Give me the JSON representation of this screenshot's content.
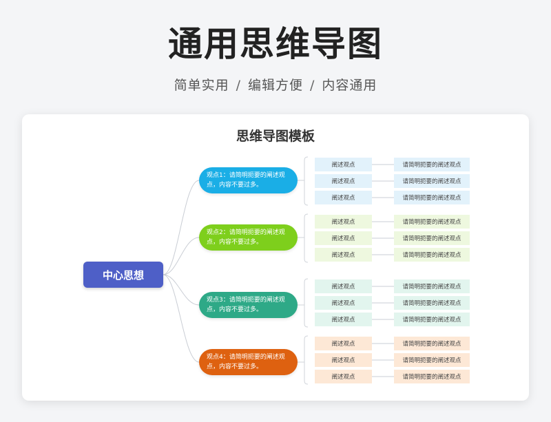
{
  "header": {
    "title": "通用思维导图",
    "tags": [
      "简单实用",
      "编辑方便",
      "内容通用"
    ],
    "separator": "/"
  },
  "template_title": "思维导图模板",
  "center": {
    "label": "中心思想",
    "color": "#4e5fc7"
  },
  "branches": [
    {
      "label": "观点1：请简明扼要的阐述观点，内容不要过多。",
      "color": "#1aaee6",
      "leaf_color": "#e2f2fb",
      "leaves": [
        {
          "left": "阐述观点",
          "right": "请简明扼要的阐述观点"
        },
        {
          "left": "阐述观点",
          "right": "请简明扼要的阐述观点"
        },
        {
          "left": "阐述观点",
          "right": "请简明扼要的阐述观点"
        }
      ]
    },
    {
      "label": "观点2：请简明扼要的阐述观点，内容不要过多。",
      "color": "#7ecf1c",
      "leaf_color": "#eef8df",
      "leaves": [
        {
          "left": "阐述观点",
          "right": "请简明扼要的阐述观点"
        },
        {
          "left": "阐述观点",
          "right": "请简明扼要的阐述观点"
        },
        {
          "left": "阐述观点",
          "right": "请简明扼要的阐述观点"
        }
      ]
    },
    {
      "label": "观点3：请简明扼要的阐述观点，内容不要过多。",
      "color": "#2ea987",
      "leaf_color": "#e2f5ee",
      "leaves": [
        {
          "left": "阐述观点",
          "right": "请简明扼要的阐述观点"
        },
        {
          "left": "阐述观点",
          "right": "请简明扼要的阐述观点"
        },
        {
          "left": "阐述观点",
          "right": "请简明扼要的阐述观点"
        }
      ]
    },
    {
      "label": "观点4：请简明扼要的阐述观点，内容不要过多。",
      "color": "#de6110",
      "leaf_color": "#fde8d6",
      "leaves": [
        {
          "left": "阐述观点",
          "right": "请简明扼要的阐述观点"
        },
        {
          "left": "阐述观点",
          "right": "请简明扼要的阐述观点"
        },
        {
          "left": "阐述观点",
          "right": "请简明扼要的阐述观点"
        }
      ]
    }
  ]
}
